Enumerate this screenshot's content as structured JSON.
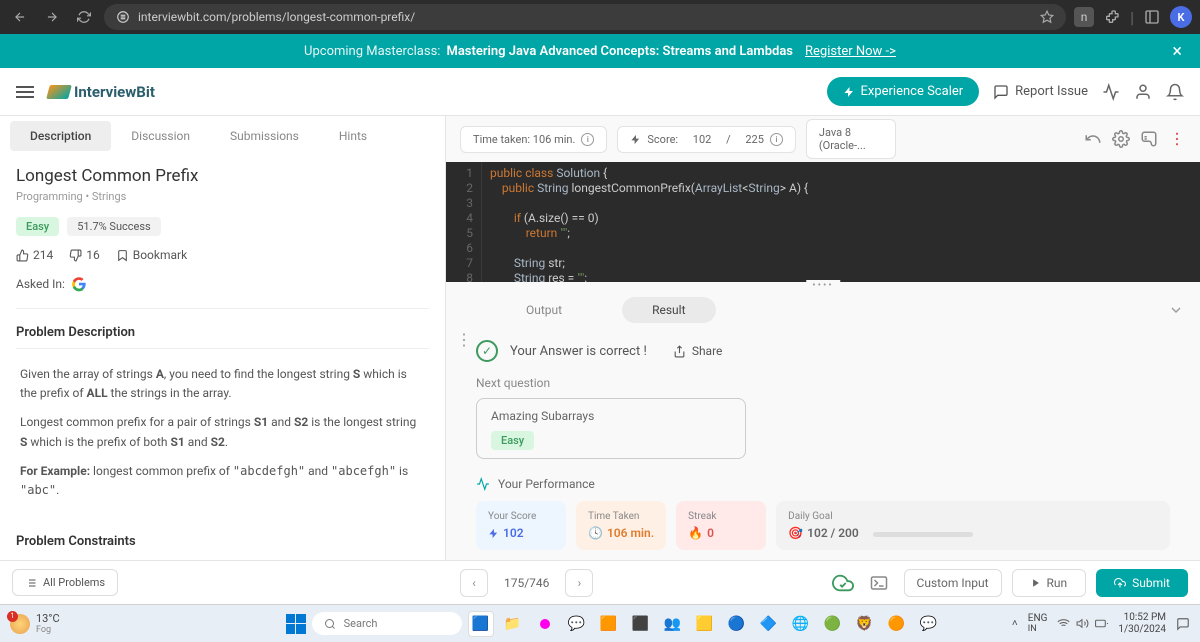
{
  "browser": {
    "url": "interviewbit.com/problems/longest-common-prefix/",
    "profile_letter": "K"
  },
  "banner": {
    "label": "Upcoming Masterclass:",
    "title": "Mastering Java Advanced Concepts: Streams and Lambdas",
    "register": "Register Now ->"
  },
  "topnav": {
    "brand": "InterviewBit",
    "experience": "Experience Scaler",
    "report": "Report Issue"
  },
  "tabs": [
    "Description",
    "Discussion",
    "Submissions",
    "Hints"
  ],
  "problem": {
    "title": "Longest Common Prefix",
    "breadcrumb": "Programming  •  Strings",
    "difficulty": "Easy",
    "success": "51.7% Success",
    "likes": "214",
    "dislikes": "16",
    "bookmark": "Bookmark",
    "asked_label": "Asked In:",
    "section1": "Problem Description",
    "section2": "Problem Constraints"
  },
  "toolbar": {
    "time": "Time taken: 106 min.",
    "score_pre": "Score:",
    "score_val": "102",
    "score_sep": "/",
    "score_total": "225",
    "lang": "Java 8 (Oracle-..."
  },
  "code": {
    "lines": [
      "1",
      "2",
      "3",
      "4",
      "5",
      "6",
      "7",
      "8"
    ]
  },
  "output": {
    "tab1": "Output",
    "tab2": "Result",
    "correct": "Your Answer is correct !",
    "share": "Share",
    "next_label": "Next question",
    "next_title": "Amazing Subarrays",
    "next_diff": "Easy",
    "perf_title": "Your Performance",
    "stats": {
      "score_label": "Your Score",
      "score_val": "102",
      "time_label": "Time Taken",
      "time_val": "106 min.",
      "streak_label": "Streak",
      "streak_val": "0",
      "goal_label": "Daily Goal",
      "goal_val": "102 / 200"
    }
  },
  "bottom": {
    "all": "All Problems",
    "page": "175/746",
    "custom_input": "Custom Input",
    "run": "Run",
    "submit": "Submit"
  },
  "taskbar": {
    "temp": "13°C",
    "cond": "Fog",
    "badge": "1",
    "search": "Search",
    "lang1": "ENG",
    "lang2": "IN",
    "time": "10:52 PM",
    "date": "1/30/2024"
  }
}
